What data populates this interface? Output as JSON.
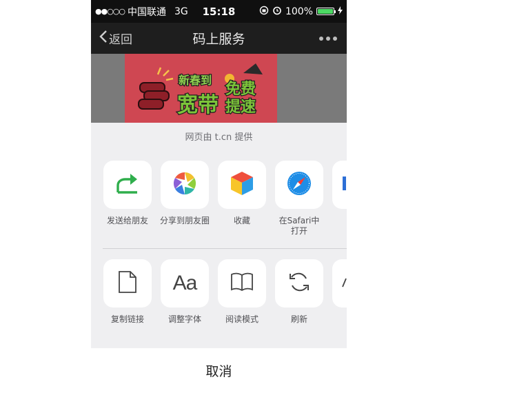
{
  "status_bar": {
    "signal": "●●○○○",
    "carrier": "中国联通",
    "network": "3G",
    "time": "15:18",
    "battery_percent": "100%",
    "battery_level": 1.0
  },
  "nav": {
    "back_label": "返回",
    "title": "码上服务"
  },
  "banner": {
    "line1": "新春到",
    "line2": "宽带",
    "line3": "免费",
    "line4": "提速",
    "colors": {
      "background": "#d04a55",
      "text_green": "#7cc43a"
    }
  },
  "sheet": {
    "provider_text": "网页由 t.cn 提供",
    "row1": [
      {
        "label": "发送给朋友",
        "icon": "share-arrow-icon"
      },
      {
        "label": "分享到朋友圈",
        "icon": "moments-aperture-icon"
      },
      {
        "label": "收藏",
        "icon": "favorite-cube-icon"
      },
      {
        "label": "在Safari中\n打开",
        "icon": "safari-compass-icon"
      }
    ],
    "row2": [
      {
        "label": "复制链接",
        "icon": "document-icon"
      },
      {
        "label": "调整字体",
        "icon": "font-aa-icon"
      },
      {
        "label": "阅读模式",
        "icon": "book-icon"
      },
      {
        "label": "刷新",
        "icon": "refresh-icon"
      }
    ],
    "cancel_label": "取消"
  }
}
